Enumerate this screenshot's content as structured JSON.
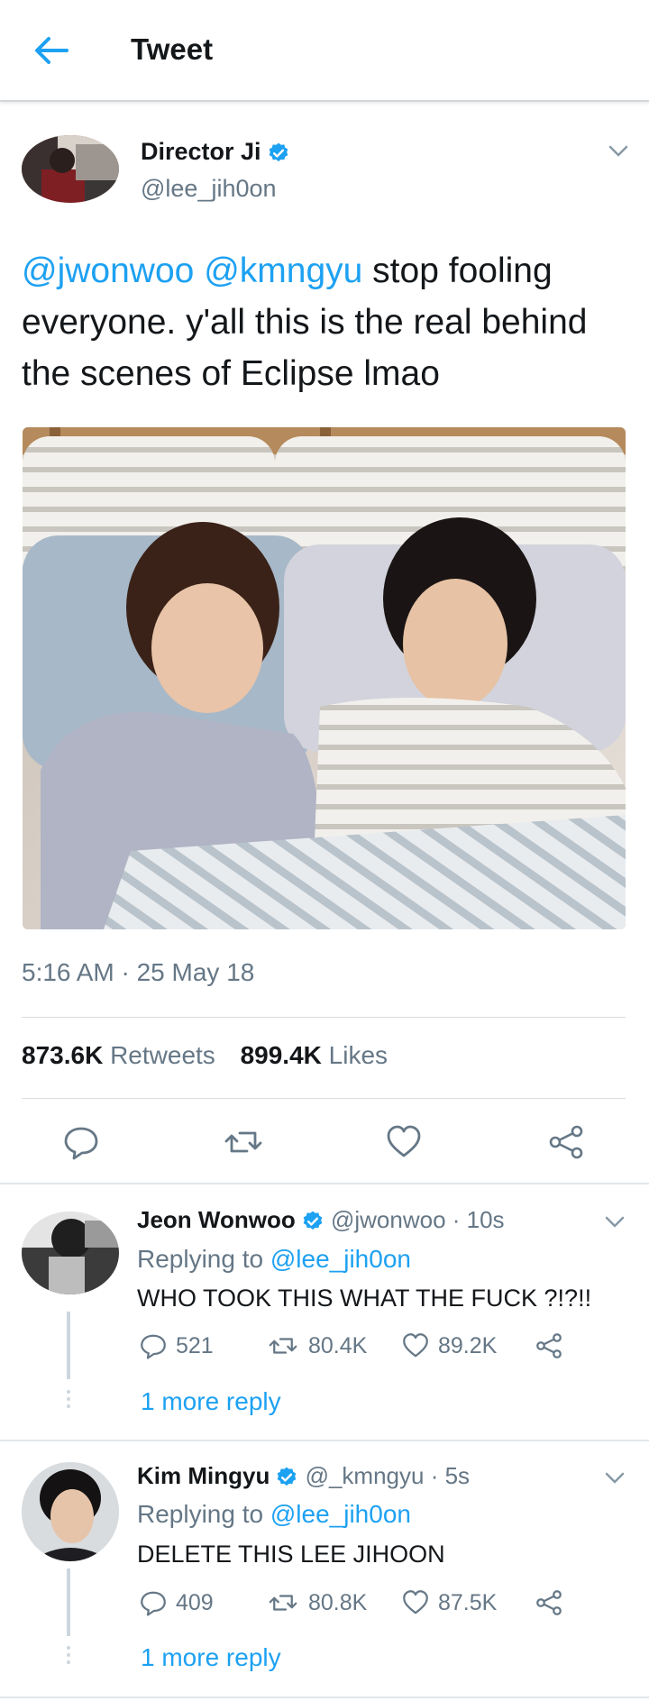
{
  "header": {
    "title": "Tweet"
  },
  "tweet": {
    "author_name": "Director Ji",
    "author_handle": "@lee_jih0on",
    "mention_1": "@jwonwoo",
    "mention_2": "@kmngyu",
    "text": " stop fooling everyone. y'all this is the real behind the scenes of Eclipse lmao",
    "timestamp": "5:16 AM · 25 May 18",
    "retweet_count": "873.6K",
    "retweet_label": "Retweets",
    "like_count": "899.4K",
    "like_label": "Likes"
  },
  "replies": [
    {
      "name": "Jeon Wonwoo",
      "handle_time": "@jwonwoo · 10s",
      "replying_prefix": "Replying to ",
      "replying_to": "@lee_jih0on",
      "text": "WHO TOOK THIS WHAT THE FUCK ?!?!!",
      "reply_count": "521",
      "retweet_count": "80.4K",
      "like_count": "89.2K",
      "more": "1 more reply"
    },
    {
      "name": "Kim Mingyu",
      "handle_time": "@_kmngyu · 5s",
      "replying_prefix": "Replying to ",
      "replying_to": "@lee_jih0on",
      "text": "DELETE THIS LEE JIHOON",
      "reply_count": "409",
      "retweet_count": "80.8K",
      "like_count": "87.5K",
      "more": "1 more reply"
    }
  ],
  "colors": {
    "accent": "#1da1f2",
    "text": "#14171a",
    "secondary": "#657786",
    "divider": "#e1e6ea"
  },
  "icons": [
    "back-arrow-icon",
    "verified-badge-icon",
    "chevron-down-icon",
    "reply-icon",
    "retweet-icon",
    "heart-icon",
    "share-icon"
  ]
}
